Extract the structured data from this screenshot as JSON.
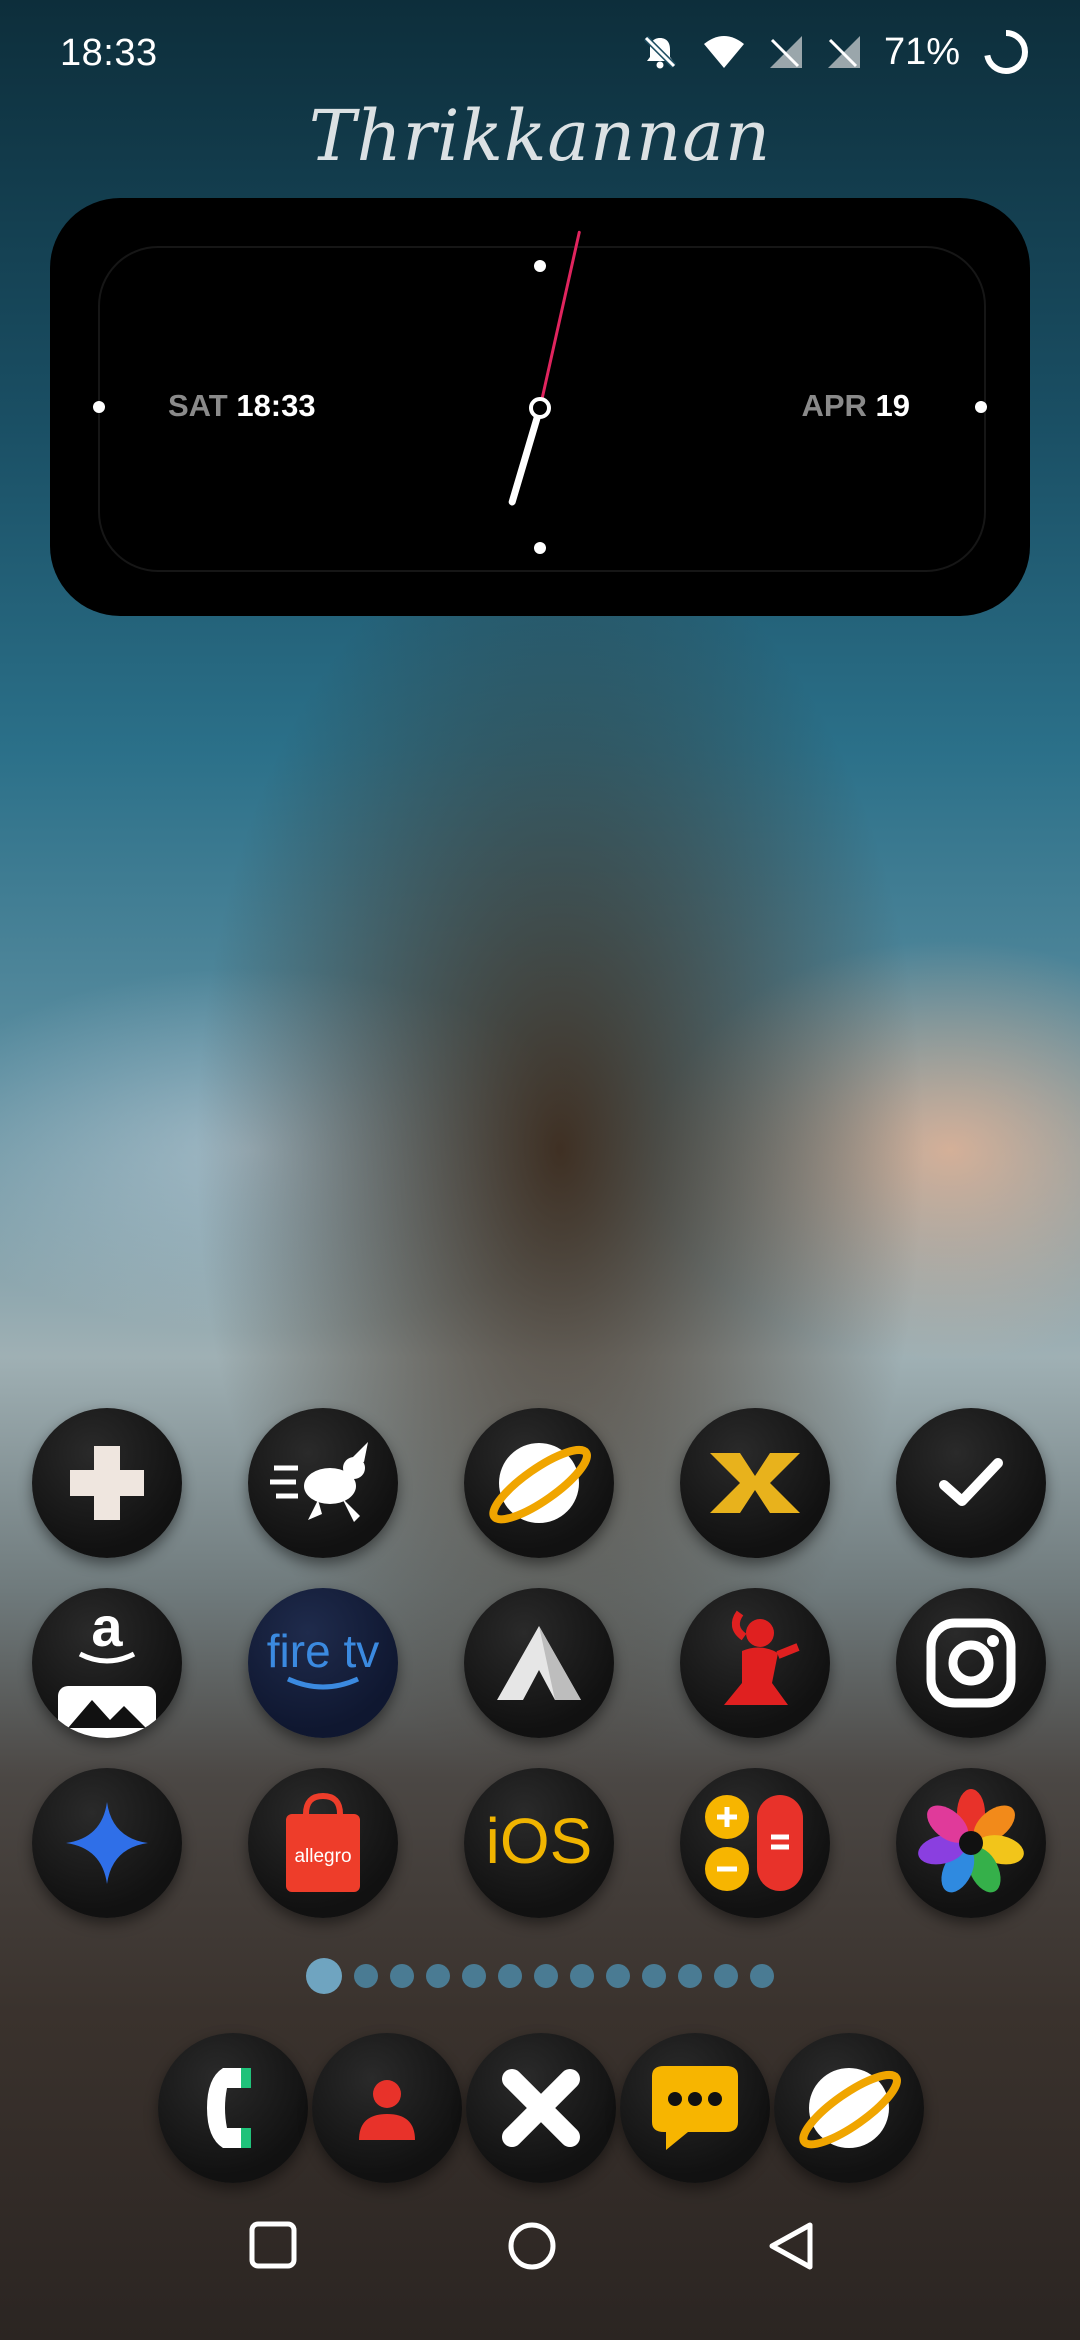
{
  "status_bar": {
    "time": "18:33",
    "battery_percent": "71%",
    "icons": [
      "bell-off-icon",
      "wifi-icon",
      "signal-off-icon",
      "signal-off-icon",
      "battery-ring-icon"
    ]
  },
  "signature_text": "Thrikkannan",
  "clock_widget": {
    "day_label": "SAT",
    "time": "18:33",
    "month_label": "APR",
    "day_number": "19",
    "hour": 18,
    "minute": 33,
    "second_hand_color": "#e0245e"
  },
  "app_grid": [
    {
      "name": "medical-cross-icon"
    },
    {
      "name": "running-rabbit-icon"
    },
    {
      "name": "planet-browser-icon"
    },
    {
      "name": "x-logo-app-icon"
    },
    {
      "name": "checkmark-app-icon"
    },
    {
      "name": "amazon-photos-icon",
      "label_glyph": "a"
    },
    {
      "name": "fire-tv-icon",
      "label_glyph": "fire tv"
    },
    {
      "name": "arc-a-icon"
    },
    {
      "name": "fitness-woman-icon"
    },
    {
      "name": "instagram-icon"
    },
    {
      "name": "sparkle-star-icon"
    },
    {
      "name": "allegro-bag-icon",
      "label_glyph": "allegro"
    },
    {
      "name": "ios-launcher-icon",
      "label_glyph": "iOS"
    },
    {
      "name": "calculator-icon"
    },
    {
      "name": "flower-photos-icon"
    }
  ],
  "page_indicator": {
    "total": 13,
    "active": 0
  },
  "dock": [
    {
      "name": "phone-icon"
    },
    {
      "name": "contacts-icon"
    },
    {
      "name": "x-close-app-icon"
    },
    {
      "name": "messages-icon"
    },
    {
      "name": "internet-planet-icon"
    }
  ],
  "nav_bar": [
    "recents-square-icon",
    "home-circle-icon",
    "back-triangle-icon"
  ]
}
